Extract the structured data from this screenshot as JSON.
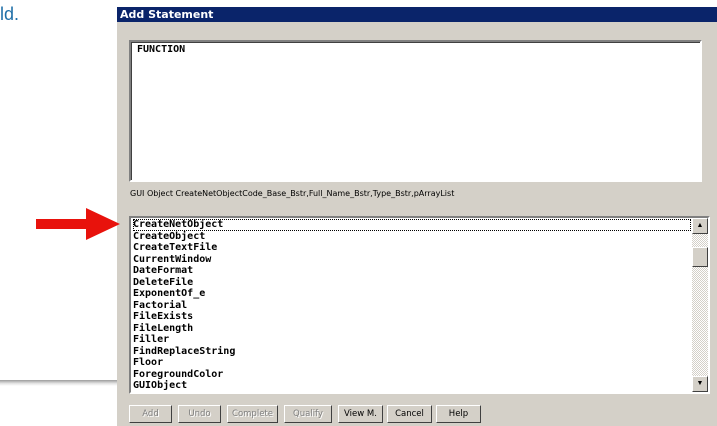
{
  "background": {
    "text": "ld."
  },
  "dialog": {
    "title": "Add Statement",
    "editor_text": "FUNCTION",
    "signature": "GUI Object CreateNetObjectCode_Base_Bstr,Full_Name_Bstr,Type_Bstr,pArrayList",
    "list_items": [
      "CreateNetObject",
      "CreateObject",
      "CreateTextFile",
      "CurrentWindow",
      "DateFormat",
      "DeleteFile",
      "ExponentOf_e",
      "Factorial",
      "FileExists",
      "FileLength",
      "Filler",
      "FindReplaceString",
      "Floor",
      "ForegroundColor",
      "GUIObject"
    ],
    "selected_item": "CreateNetObject",
    "buttons": {
      "add": "Add",
      "undo": "Undo",
      "complete": "Complete",
      "qualify": "Qualify",
      "view": "View M.",
      "cancel": "Cancel",
      "help": "Help"
    }
  },
  "colors": {
    "title_bar": "#0a246a",
    "dialog_face": "#d4d0c8",
    "arrow": "#e8120c"
  }
}
